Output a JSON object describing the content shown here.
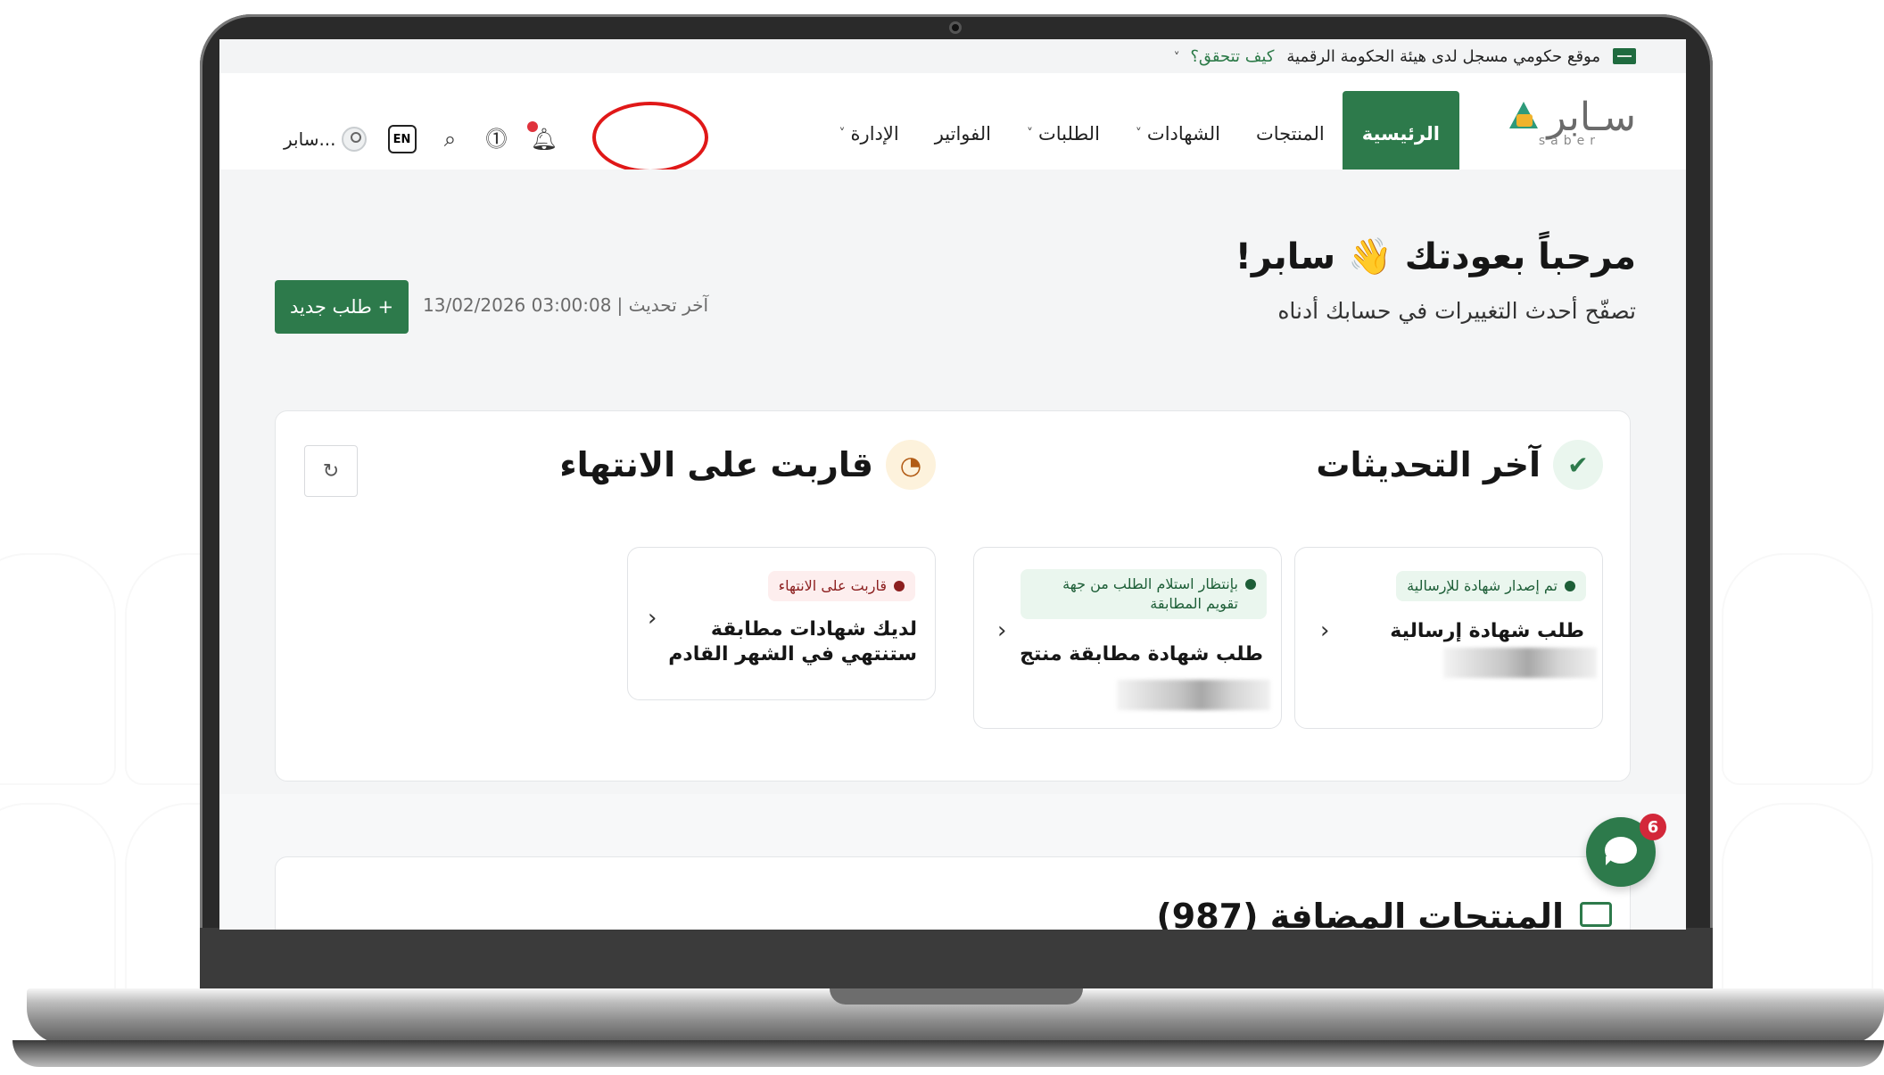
{
  "topbar": {
    "gov_text": "موقع حكومي مسجل لدى هيئة الحكومة الرقمية",
    "verify_label": "كيف تتحقق؟"
  },
  "logo": {
    "arabic": "سـابر",
    "english": "saber"
  },
  "nav": {
    "items": [
      {
        "label": "الرئيسية",
        "active": true,
        "dropdown": false
      },
      {
        "label": "المنتجات",
        "active": false,
        "dropdown": false,
        "highlighted": true
      },
      {
        "label": "الشهادات",
        "active": false,
        "dropdown": true
      },
      {
        "label": "الطلبات",
        "active": false,
        "dropdown": true
      },
      {
        "label": "الفواتير",
        "active": false,
        "dropdown": false
      },
      {
        "label": "الإدارة",
        "active": false,
        "dropdown": true
      }
    ],
    "user_name": "سابر...",
    "lang_toggle": "EN"
  },
  "hero": {
    "welcome_title": "مرحباً بعودتك 👋 سابر!",
    "welcome_subtitle": "تصفّح أحدث التغييرات في حسابك أدناه",
    "last_update_label": "آخر تحديث |",
    "last_update_value": "13/02/2026 03:00:08",
    "new_request_label": "+ طلب جديد"
  },
  "updates": {
    "title": "آخر التحديثات",
    "cards": [
      {
        "badge": "تم إصدار شهادة للإرسالية",
        "title": "طلب شهادة إرسالية"
      },
      {
        "badge": "بإنتظار استلام الطلب من جهة تقويم المطابقة",
        "title": "طلب شهادة مطابقة منتج"
      }
    ]
  },
  "expiring": {
    "title": "قاربت على الانتهاء",
    "card": {
      "badge": "قاربت على الانتهاء",
      "title": "لديك شهادات مطابقة ستنتهي في الشهر القادم"
    }
  },
  "bottom": {
    "title": "المنتجات المضافة (987)"
  },
  "chat": {
    "count": "6"
  },
  "colors": {
    "brand_green": "#2d7a4b",
    "badge_green_bg": "#eaf6ee",
    "badge_red_bg": "#fdeeee",
    "badge_red_text": "#8c1f1f",
    "highlight_ring": "#e01818"
  }
}
